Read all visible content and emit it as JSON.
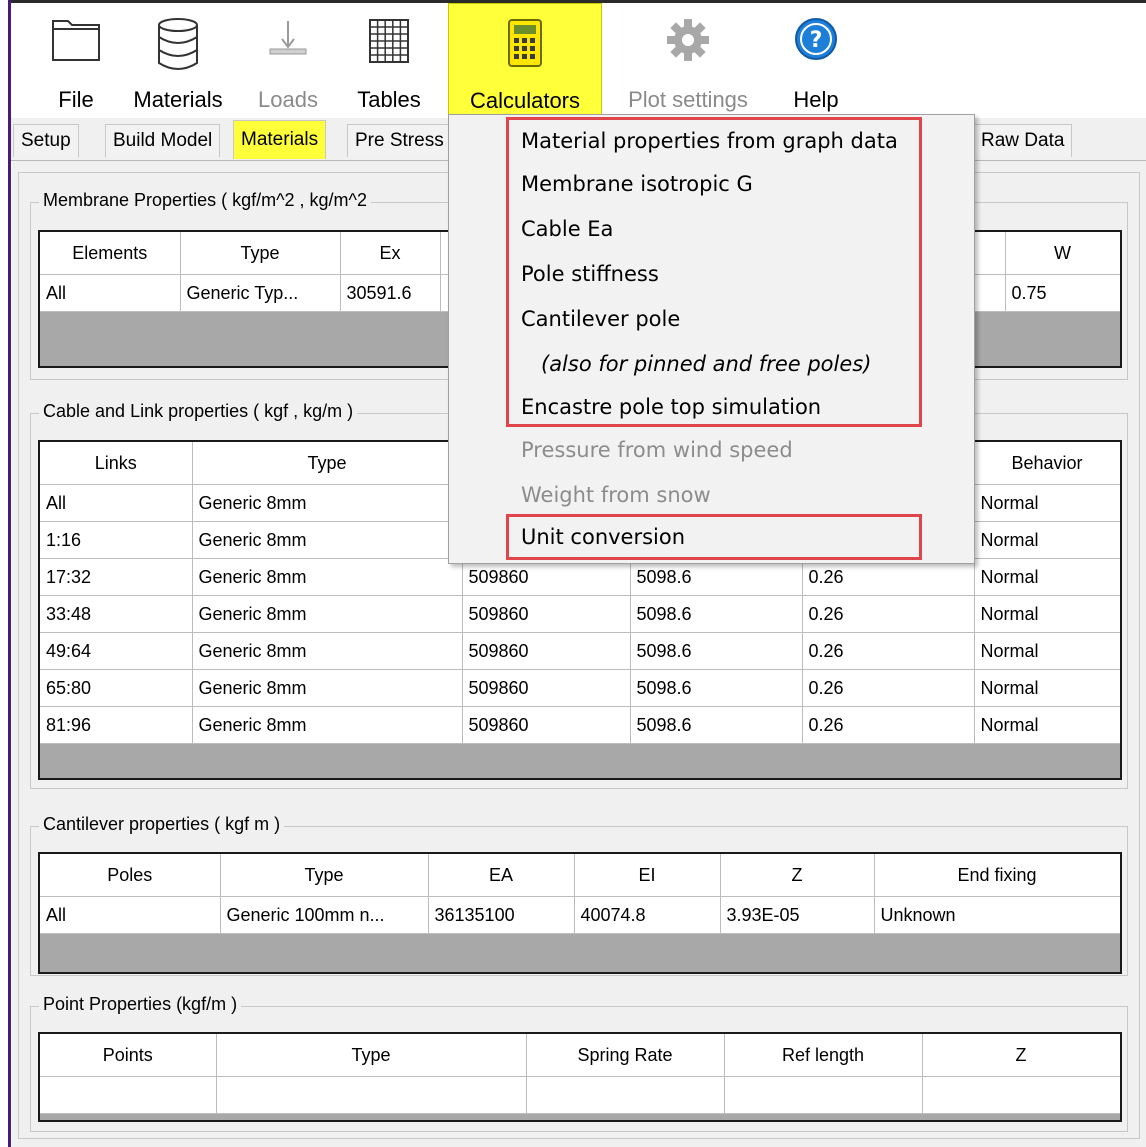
{
  "toolbar": {
    "file": "File",
    "materials": "Materials",
    "loads": "Loads",
    "tables": "Tables",
    "calculators": "Calculators",
    "plot_settings": "Plot settings",
    "help": "Help"
  },
  "tabs": {
    "setup": "Setup",
    "build_model": "Build Model",
    "materials": "Materials",
    "pre_stress": "Pre Stress",
    "raw_data": "Raw Data"
  },
  "membrane": {
    "title": "Membrane Properties ( kgf/m^2 , kg/m^2",
    "headers": {
      "elements": "Elements",
      "type": "Type",
      "ex": "Ex",
      "w": "W"
    },
    "row": {
      "elements": "All",
      "type": "Generic Typ...",
      "ex": "30591.6",
      "w": "0.75"
    }
  },
  "cable": {
    "title": "Cable and Link properties ( kgf , kg/m )",
    "headers": {
      "links": "Links",
      "type": "Type",
      "behavior": "Behavior"
    },
    "rows": [
      {
        "links": "All",
        "type": "Generic 8mm",
        "c3": "",
        "c4": "",
        "c5": "",
        "behavior": "Normal"
      },
      {
        "links": "1:16",
        "type": "Generic 8mm",
        "c3": "",
        "c4": "",
        "c5": "",
        "behavior": "Normal"
      },
      {
        "links": "17:32",
        "type": "Generic 8mm",
        "c3": "509860",
        "c4": "5098.6",
        "c5": "0.26",
        "behavior": "Normal"
      },
      {
        "links": "33:48",
        "type": "Generic 8mm",
        "c3": "509860",
        "c4": "5098.6",
        "c5": "0.26",
        "behavior": "Normal"
      },
      {
        "links": "49:64",
        "type": "Generic 8mm",
        "c3": "509860",
        "c4": "5098.6",
        "c5": "0.26",
        "behavior": "Normal"
      },
      {
        "links": "65:80",
        "type": "Generic 8mm",
        "c3": "509860",
        "c4": "5098.6",
        "c5": "0.26",
        "behavior": "Normal"
      },
      {
        "links": "81:96",
        "type": "Generic 8mm",
        "c3": "509860",
        "c4": "5098.6",
        "c5": "0.26",
        "behavior": "Normal"
      }
    ]
  },
  "cantilever": {
    "title": "Cantilever properties ( kgf m )",
    "headers": {
      "poles": "Poles",
      "type": "Type",
      "ea": "EA",
      "ei": "EI",
      "z": "Z",
      "end_fixing": "End fixing"
    },
    "row": {
      "poles": "All",
      "type": "Generic 100mm n...",
      "ea": "36135100",
      "ei": "40074.8",
      "z": "3.93E-05",
      "end_fixing": "Unknown"
    }
  },
  "point": {
    "title": "Point Properties  (kgf/m )",
    "headers": {
      "points": "Points",
      "type": "Type",
      "spring_rate": "Spring Rate",
      "ref_length": "Ref length",
      "z": "Z"
    }
  },
  "menu": {
    "items": [
      "Material properties from graph data",
      "Membrane isotropic G",
      "Cable Ea",
      "Pole stiffness",
      "Cantilever pole",
      "(also for pinned and free poles)",
      "Encastre pole top simulation",
      "Pressure from wind speed",
      "Weight from snow",
      "Unit conversion"
    ]
  },
  "colors": {
    "highlight": "#ffff3a",
    "annotation": "#e0454b",
    "help_icon": "#1e7fd8"
  }
}
